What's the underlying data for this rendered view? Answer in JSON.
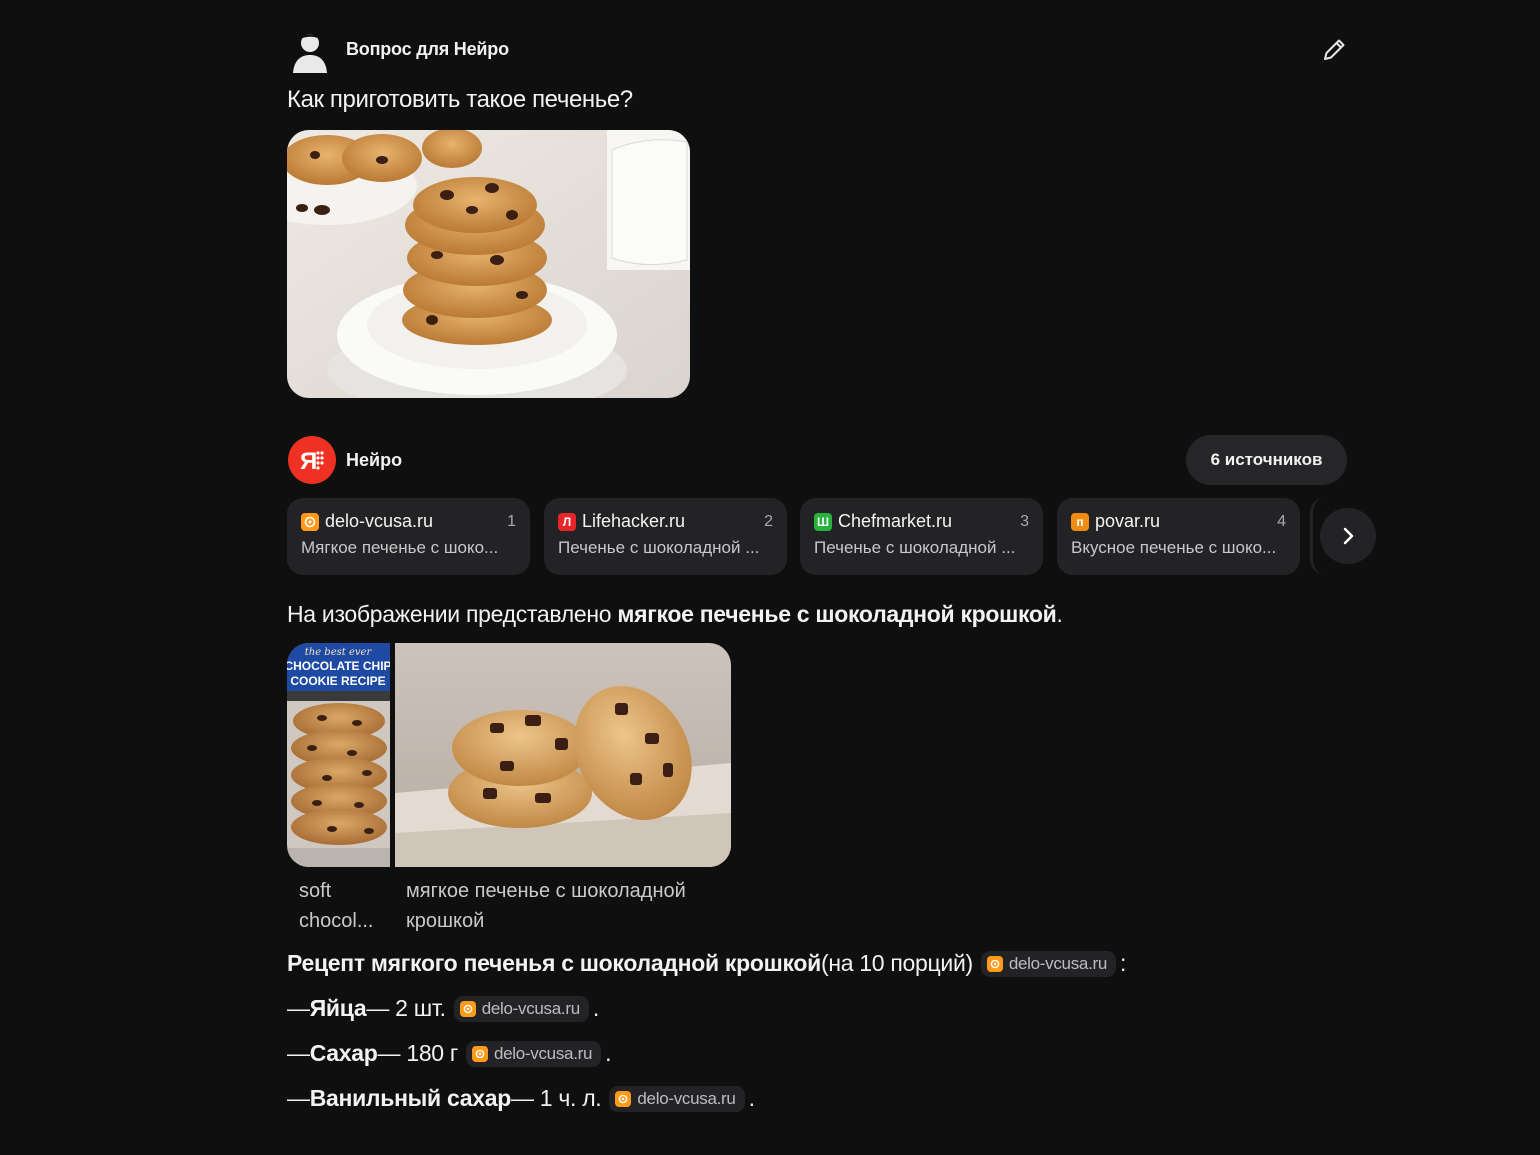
{
  "header": {
    "user_label": "Вопрос для Нейро",
    "question": "Как приготовить такое печенье?"
  },
  "neuro": {
    "title": "Нейро",
    "sources_button": "6 источников",
    "sources": [
      {
        "name": "delo-vcusa.ru",
        "num": "1",
        "desc": "Мягкое печенье с шоко...",
        "fav_color": "#ff9a1a",
        "fav_char": ""
      },
      {
        "name": "Lifehacker.ru",
        "num": "2",
        "desc": "Печенье с шоколадной ...",
        "fav_color": "#e8262a",
        "fav_char": "Л"
      },
      {
        "name": "Chefmarket.ru",
        "num": "3",
        "desc": "Печенье с шоколадной ...",
        "fav_color": "#27b33b",
        "fav_char": "Ш"
      },
      {
        "name": "povar.ru",
        "num": "4",
        "desc": "Вкусное печенье с шоко...",
        "fav_color": "#f08c12",
        "fav_char": "п"
      }
    ]
  },
  "answer": {
    "intro_plain": "На изображении представлено ",
    "intro_bold": "мягкое печенье с шоколадной крошкой",
    "intro_end": ".",
    "thumb1_banner": [
      "the best ever",
      "CHOCOLATE CHIP",
      "COOKIE RECIPE"
    ],
    "captions": [
      "soft chocol...",
      "мягкое печенье с шоколадной крошкой"
    ],
    "recipe_bold": "Рецепт мягкого печенья с шоколадной крошкой",
    "recipe_plain": " (на 10 порций)",
    "recipe_end": ":",
    "chip_label": "delo-vcusa.ru",
    "ingredients": [
      {
        "dash": "— ",
        "name": "Яйца",
        "amount": " — 2 шт."
      },
      {
        "dash": "— ",
        "name": "Сахар",
        "amount": " — 180 г"
      },
      {
        "dash": "— ",
        "name": "Ванильный сахар",
        "amount": " — 1 ч. л."
      }
    ],
    "period": "."
  }
}
